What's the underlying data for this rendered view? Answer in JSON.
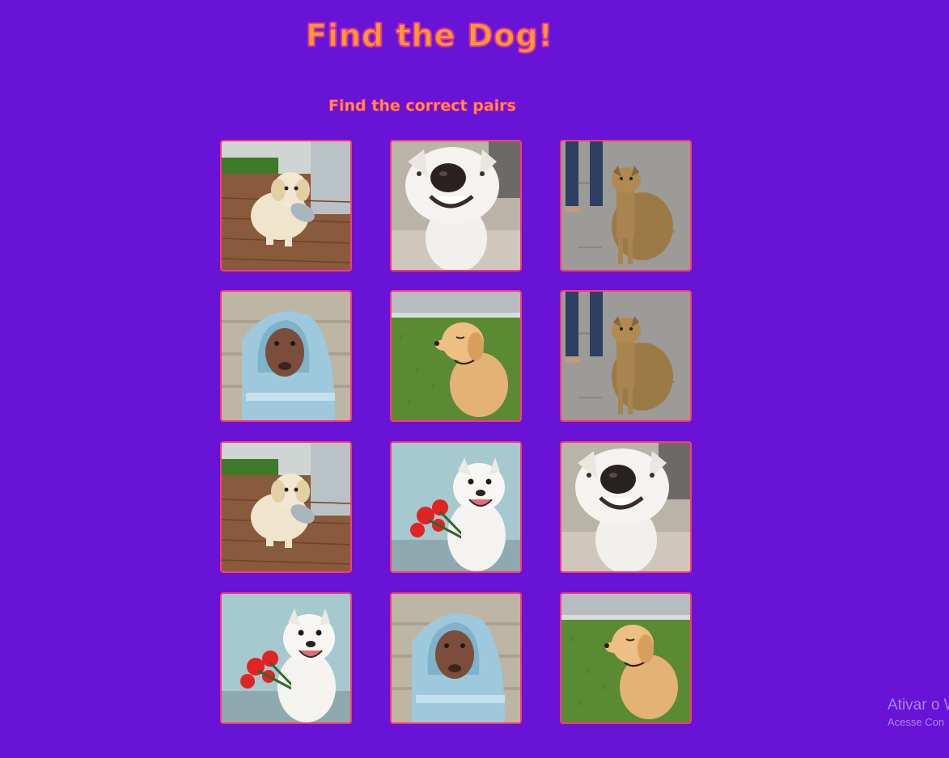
{
  "header": {
    "title": "Find the Dog!",
    "subtitle": "Find the correct pairs"
  },
  "colors": {
    "background": "#6813d6",
    "title_fill": "#ff9a2e",
    "title_outline": "#f0308a",
    "card_border": "#ff3a6e"
  },
  "cards": [
    {
      "dog": "golden-puppy-with-bowl"
    },
    {
      "dog": "smiling-white-dog-closeup"
    },
    {
      "dog": "tan-dog-sitting-on-street"
    },
    {
      "dog": "chihuahua-in-blue-hoodie"
    },
    {
      "dog": "golden-puppy-on-grass"
    },
    {
      "dog": "tan-dog-sitting-on-street"
    },
    {
      "dog": "golden-puppy-with-bowl"
    },
    {
      "dog": "white-dog-with-red-flowers"
    },
    {
      "dog": "smiling-white-dog-closeup"
    },
    {
      "dog": "white-dog-with-red-flowers"
    },
    {
      "dog": "chihuahua-in-blue-hoodie"
    },
    {
      "dog": "golden-puppy-on-grass"
    }
  ],
  "windows_activation": {
    "line1": "Ativar o W",
    "line2": "Acesse Con"
  }
}
